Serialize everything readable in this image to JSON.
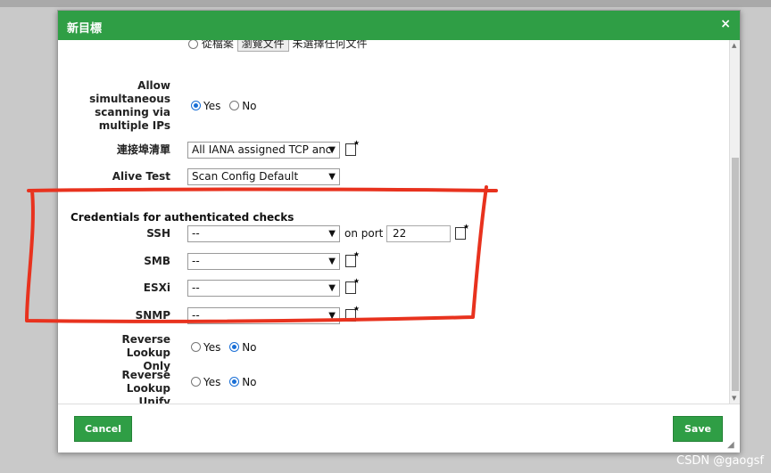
{
  "dialog": {
    "title": "新目標",
    "close_label": "×"
  },
  "clipped_row": {
    "label": "從檔案",
    "button": "瀏覽文件",
    "text": "未選擇任何文件"
  },
  "simultaneous": {
    "label_lines": [
      "Allow",
      "simultaneous",
      "scanning via",
      "multiple IPs"
    ],
    "yes": "Yes",
    "no": "No",
    "selected": "Yes"
  },
  "port_list": {
    "label": "連接埠清單",
    "value": "All IANA assigned TCP anc"
  },
  "alive_test": {
    "label": "Alive Test",
    "value": "Scan Config Default"
  },
  "credentials": {
    "heading": "Credentials for authenticated checks",
    "ssh_label": "SSH",
    "ssh_value": "--",
    "on_port": "on port",
    "port_value": "22",
    "smb_label": "SMB",
    "smb_value": "--",
    "esxi_label": "ESXi",
    "esxi_value": "--",
    "snmp_label": "SNMP",
    "snmp_value": "--"
  },
  "reverse_lookup_only": {
    "label_lines": [
      "Reverse Lookup",
      "Only"
    ],
    "yes": "Yes",
    "no": "No",
    "selected": "No"
  },
  "reverse_lookup_unify": {
    "label_lines": [
      "Reverse Lookup",
      "Unify"
    ],
    "yes": "Yes",
    "no": "No",
    "selected": "No"
  },
  "footer": {
    "cancel": "Cancel",
    "save": "Save"
  },
  "annotation_color": "#e8321e",
  "watermark": "CSDN @gaogsf"
}
